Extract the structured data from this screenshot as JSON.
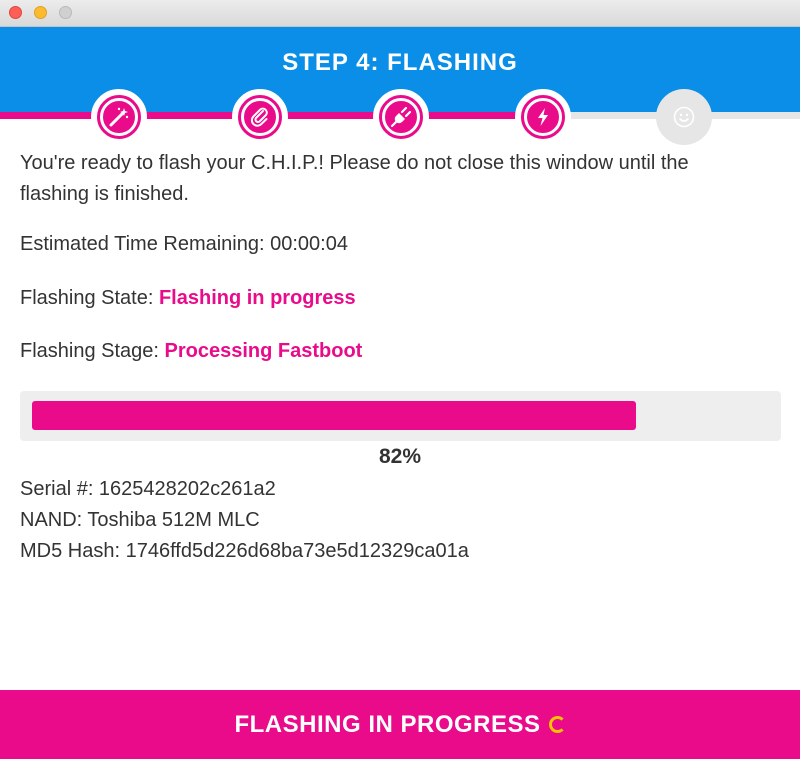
{
  "window": {
    "title": "",
    "controls": [
      "close",
      "minimize",
      "zoom"
    ]
  },
  "header": {
    "title": "STEP 4: FLASHING"
  },
  "steps": [
    {
      "icon": "magic-wand-icon",
      "state": "complete"
    },
    {
      "icon": "paperclip-icon",
      "state": "complete"
    },
    {
      "icon": "plug-icon",
      "state": "complete"
    },
    {
      "icon": "lightning-bolt-icon",
      "state": "active"
    },
    {
      "icon": "smiley-face-icon",
      "state": "pending"
    }
  ],
  "content": {
    "intro": "You're ready to flash your C.H.I.P.! Please do not close this window until the flashing is finished.",
    "time_remaining": "Estimated Time Remaining: 00:00:04",
    "state_label": "Flashing State: ",
    "state_value": "Flashing in progress",
    "stage_label": "Flashing Stage: ",
    "stage_value": "Processing Fastboot"
  },
  "progress": {
    "value": 0.82,
    "label": "82%"
  },
  "device": {
    "serial": "Serial #: 1625428202c261a2",
    "nand": "NAND: Toshiba 512M MLC",
    "md5": "MD5 Hash: 1746ffd5d226d68ba73e5d12329ca01a"
  },
  "footer": {
    "label": "FLASHING IN PROGRESS"
  },
  "colors": {
    "brand_blue": "#0a8ee7",
    "accent_pink": "#ea0b8b",
    "spinner_yellow": "#f5c400",
    "pending_gray": "#e6e6e6"
  }
}
